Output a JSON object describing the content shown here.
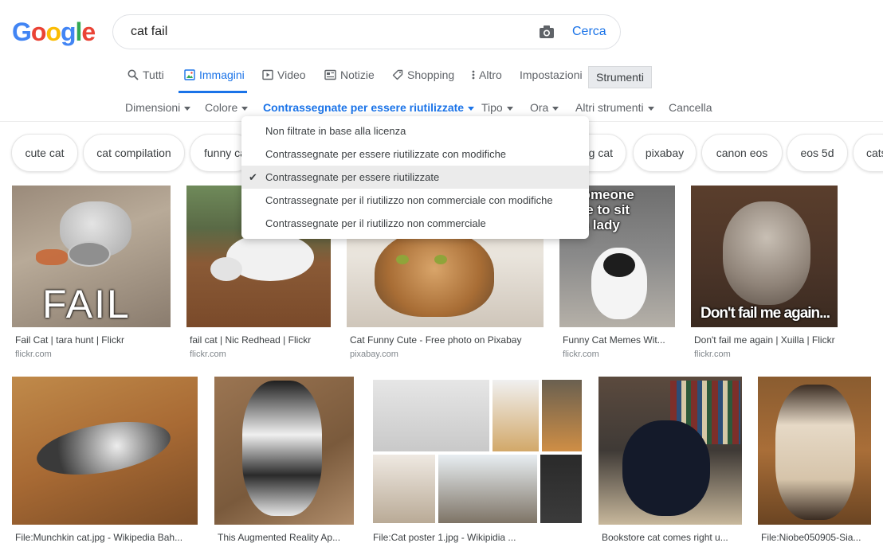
{
  "logo": {
    "letters": [
      "G",
      "o",
      "o",
      "g",
      "l",
      "e"
    ],
    "colors": [
      "#4285F4",
      "#EA4335",
      "#FBBC05",
      "#4285F4",
      "#34A853",
      "#EA4335"
    ]
  },
  "search": {
    "query": "cat fail",
    "button_label": "Cerca",
    "camera_icon": "camera-icon"
  },
  "tabs": {
    "all": "Tutti",
    "images": "Immagini",
    "video": "Video",
    "news": "Notizie",
    "shopping": "Shopping",
    "more": "Altro",
    "settings": "Impostazioni",
    "tools": "Strumenti"
  },
  "filters": {
    "size": "Dimensioni",
    "color": "Colore",
    "license": "Contrassegnate per essere riutilizzate",
    "type": "Tipo",
    "time": "Ora",
    "more_tools": "Altri strumenti",
    "clear": "Cancella"
  },
  "license_menu": {
    "items": [
      "Non filtrate in base alla licenza",
      "Contrassegnate per essere riutilizzate con modifiche",
      "Contrassegnate per essere riutilizzate",
      "Contrassegnate per il riutilizzo non commerciale con modifiche",
      "Contrassegnate per il riutilizzo non commerciale"
    ],
    "selected_index": 2
  },
  "chips": [
    "cute cat",
    "cat compilation",
    "funny ca",
    "g cat",
    "pixabay",
    "canon eos",
    "eos 5d",
    "cats"
  ],
  "results_row1": [
    {
      "caption": "Fail Cat | tara hunt | Flickr",
      "source": "flickr.com",
      "overlay": "FAIL"
    },
    {
      "caption": "fail cat | Nic Redhead | Flickr",
      "source": "flickr.com"
    },
    {
      "caption": "Cat Funny Cute - Free photo on Pixabay",
      "source": "pixabay.com"
    },
    {
      "caption": "Funny Cat Memes Wit...",
      "source": "flickr.com",
      "overlay_lines": [
        "n someone",
        "s me to sit",
        "ke a lady"
      ]
    },
    {
      "caption": "Don't fail me again | Xuilla | Flickr",
      "source": "flickr.com",
      "overlay": "Don't fail me again..."
    }
  ],
  "results_row2": [
    {
      "caption": "File:Munchkin cat.jpg - Wikipedia Bah..."
    },
    {
      "caption": "This Augmented Reality Ap..."
    },
    {
      "caption": "File:Cat poster 1.jpg - Wikipidia ..."
    },
    {
      "caption": "Bookstore cat comes right u..."
    },
    {
      "caption": "File:Niobe050905-Sia..."
    }
  ]
}
